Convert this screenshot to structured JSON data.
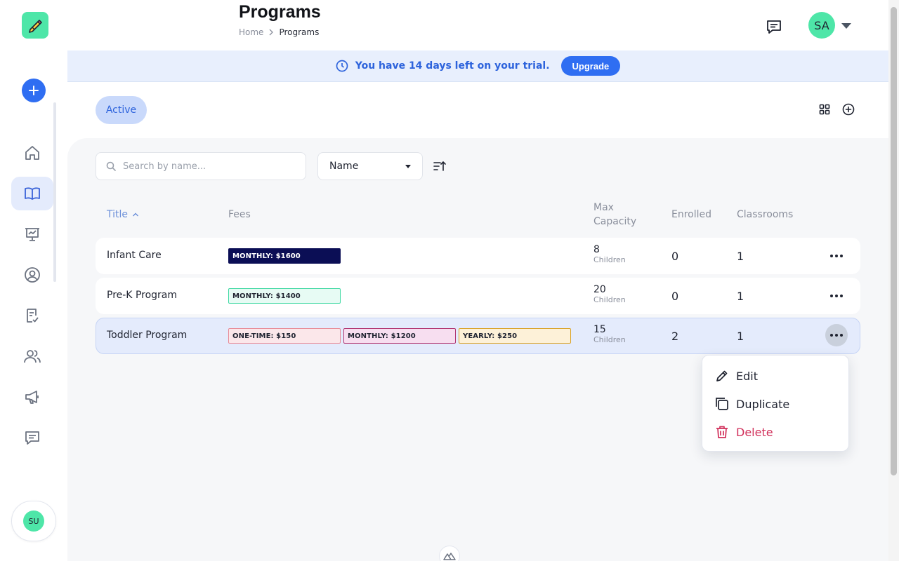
{
  "header": {
    "title": "Programs",
    "breadcrumb": {
      "home": "Home",
      "current": "Programs"
    },
    "user_initials": "SA"
  },
  "banner": {
    "message": "You have 14 days left on your trial.",
    "upgrade_label": "Upgrade"
  },
  "tabs": {
    "active_label": "Active"
  },
  "toolbar": {
    "search_placeholder": "Search by name...",
    "sort_value": "Name"
  },
  "table": {
    "headers": {
      "title": "Title",
      "fees": "Fees",
      "max_capacity_1": "Max",
      "max_capacity_2": "Capacity",
      "enrolled": "Enrolled",
      "classrooms": "Classrooms"
    },
    "rows": [
      {
        "title": "Infant Care",
        "fees": [
          "MONTHLY: $1600"
        ],
        "capacity": "8",
        "capacity_unit": "Children",
        "enrolled": "0",
        "classrooms": "1"
      },
      {
        "title": "Pre-K Program",
        "fees": [
          "MONTHLY: $1400"
        ],
        "capacity": "20",
        "capacity_unit": "Children",
        "enrolled": "0",
        "classrooms": "1"
      },
      {
        "title": "Toddler Program",
        "fees": [
          "ONE-TIME: $150",
          "MONTHLY: $1200",
          "YEARLY: $250"
        ],
        "capacity": "15",
        "capacity_unit": "Children",
        "enrolled": "2",
        "classrooms": "1"
      }
    ]
  },
  "menu": {
    "edit": "Edit",
    "duplicate": "Duplicate",
    "delete": "Delete"
  },
  "sidebar": {
    "user_initials": "SU",
    "items": [
      "home-icon",
      "book-icon",
      "presentation-icon",
      "user-circle-icon",
      "checklist-icon",
      "users-icon",
      "megaphone-icon",
      "message-icon"
    ]
  },
  "colors": {
    "accent": "#2f6ef2",
    "brand_green": "#4ee6a8",
    "danger": "#d12f5a",
    "fee_dark": "#0b0e55"
  }
}
